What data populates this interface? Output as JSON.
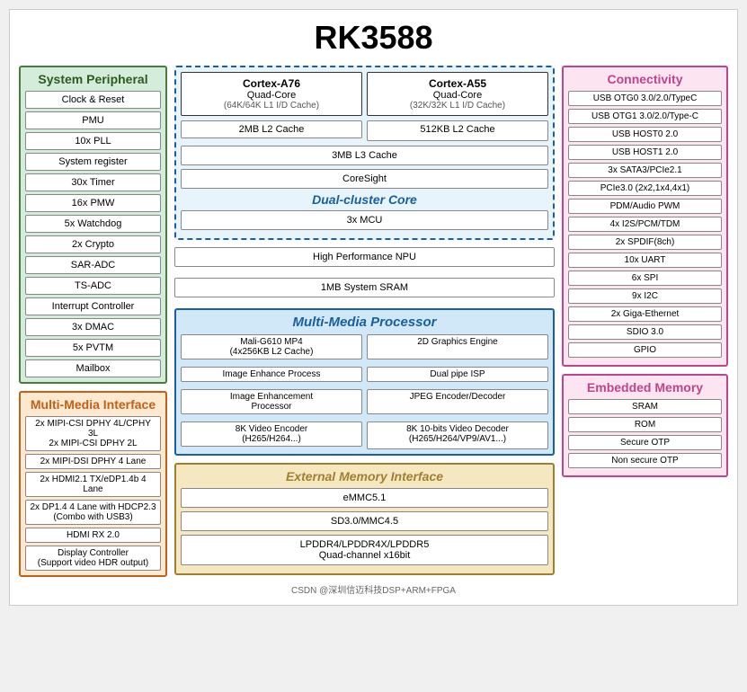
{
  "title": "RK3588",
  "sections": {
    "sys_peripheral": {
      "title": "System Peripheral",
      "items": [
        "Clock & Reset",
        "PMU",
        "10x PLL",
        "System register",
        "30x Timer",
        "16x PMW",
        "5x Watchdog",
        "2x Crypto",
        "SAR-ADC",
        "TS-ADC",
        "Interrupt Controller",
        "3x DMAC",
        "5x PVTM",
        "Mailbox"
      ]
    },
    "mm_interface": {
      "title": "Multi-Media Interface",
      "items": [
        "2x MIPI-CSI DPHY 4L/CPHY 3L\n2x MIPI-CSI DPHY 2L",
        "2x MIPI-DSI DPHY 4 Lane",
        "2x HDMI2.1 TX/eDP1.4b 4 Lane",
        "2x DP1.4 4 Lane with HDCP2.3\n(Combo with USB3)",
        "HDMI RX 2.0",
        "Display Controller\n(Support video HDR output)"
      ]
    },
    "dual_cluster": {
      "title": "Dual-cluster Core",
      "cpu_a76": {
        "name": "Cortex-A76",
        "sub1": "Quad-Core",
        "sub2": "(64K/64K L1 I/D Cache)"
      },
      "cpu_a55": {
        "name": "Cortex-A55",
        "sub1": "Quad-Core",
        "sub2": "(32K/32K L1 I/D Cache)"
      },
      "l2_cache_a76": "2MB L2 Cache",
      "l2_cache_a55": "512KB L2 Cache",
      "l3_cache": "3MB L3 Cache",
      "coresight": "CoreSight",
      "mcu": "3x MCU"
    },
    "npu": "High Performance NPU",
    "sram": "1MB System SRAM",
    "mm_processor": {
      "title": "Multi-Media Processor",
      "gpu": "Mali-G610 MP4\n(4x256KB L2 Cache)",
      "graphics_2d": "2D Graphics Engine",
      "image_enhance": "Image Enhance Process",
      "dual_pipe_isp": "Dual pipe ISP",
      "image_enhancement": "Image Enhancement\nProcessor",
      "jpeg": "JPEG Encoder/Decoder",
      "video_encoder": "8K Video Encoder\n(H265/H264...)",
      "video_decoder": "8K 10-bits Video Decoder\n(H265/H264/VP9/AV1...)"
    },
    "ext_mem": {
      "title": "External Memory Interface",
      "items": [
        "eMMC5.1",
        "SD3.0/MMC4.5",
        "LPDDR4/LPDDR4X/LPDDR5\nQuad-channel x16bit"
      ]
    },
    "connectivity": {
      "title": "Connectivity",
      "items": [
        "USB OTG0 3.0/2.0/TypeC",
        "USB OTG1 3.0/2.0/Type-C",
        "USB HOST0 2.0",
        "USB HOST1 2.0",
        "3x SATA3/PCIe2.1",
        "PCIe3.0 (2x2,1x4,4x1)",
        "PDM/Audio PWM",
        "4x I2S/PCM/TDM",
        "2x SPDIF(8ch)",
        "10x UART",
        "6x SPI",
        "9x I2C",
        "2x Giga-Ethernet",
        "SDIO 3.0",
        "GPIO"
      ]
    },
    "embedded_mem": {
      "title": "Embedded Memory",
      "items": [
        "SRAM",
        "ROM",
        "Secure OTP",
        "Non secure OTP"
      ]
    }
  },
  "footer": "CSDN @深圳信迈科技DSP+ARM+FPGA"
}
